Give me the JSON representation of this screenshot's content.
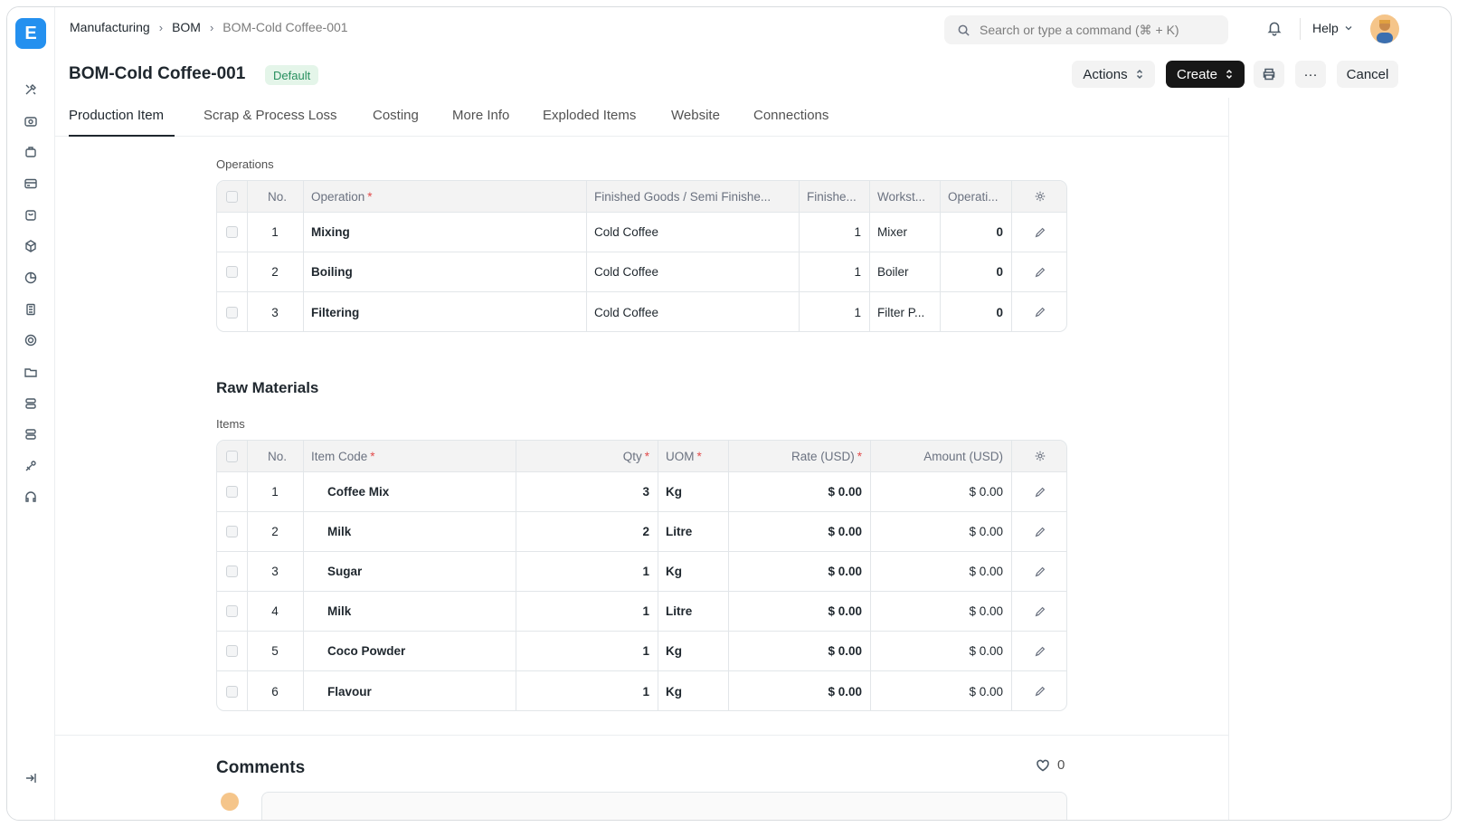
{
  "breadcrumb": [
    "Manufacturing",
    "BOM",
    "BOM-Cold Coffee-001"
  ],
  "search": {
    "placeholder": "Search or type a command (⌘ + K)"
  },
  "header": {
    "help_label": "Help"
  },
  "page": {
    "title": "BOM-Cold Coffee-001",
    "status_badge": "Default",
    "actions_label": "Actions",
    "create_label": "Create",
    "more_label": "···",
    "cancel_label": "Cancel"
  },
  "tabs": [
    "Production Item",
    "Scrap & Process Loss",
    "Costing",
    "More Info",
    "Exploded Items",
    "Website",
    "Connections"
  ],
  "operations": {
    "label": "Operations",
    "columns": [
      "No.",
      "Operation",
      "Finished Goods / Semi Finishe...",
      "Finishe...",
      "Workst...",
      "Operati..."
    ],
    "rows": [
      {
        "no": "1",
        "operation": "Mixing",
        "finished_goods": "Cold Coffee",
        "finished_qty": "1",
        "workstation": "Mixer",
        "operating_cost": "0"
      },
      {
        "no": "2",
        "operation": "Boiling",
        "finished_goods": "Cold Coffee",
        "finished_qty": "1",
        "workstation": "Boiler",
        "operating_cost": "0"
      },
      {
        "no": "3",
        "operation": "Filtering",
        "finished_goods": "Cold Coffee",
        "finished_qty": "1",
        "workstation": "Filter P...",
        "operating_cost": "0"
      }
    ]
  },
  "raw_materials": {
    "title": "Raw Materials",
    "items_label": "Items",
    "columns": [
      "No.",
      "Item Code",
      "Qty",
      "UOM",
      "Rate (USD)",
      "Amount (USD)"
    ],
    "rows": [
      {
        "no": "1",
        "item_code": "Coffee Mix",
        "qty": "3",
        "uom": "Kg",
        "rate": "$ 0.00",
        "amount": "$ 0.00"
      },
      {
        "no": "2",
        "item_code": "Milk",
        "qty": "2",
        "uom": "Litre",
        "rate": "$ 0.00",
        "amount": "$ 0.00"
      },
      {
        "no": "3",
        "item_code": "Sugar",
        "qty": "1",
        "uom": "Kg",
        "rate": "$ 0.00",
        "amount": "$ 0.00"
      },
      {
        "no": "4",
        "item_code": "Milk",
        "qty": "1",
        "uom": "Litre",
        "rate": "$ 0.00",
        "amount": "$ 0.00"
      },
      {
        "no": "5",
        "item_code": "Coco Powder",
        "qty": "1",
        "uom": "Kg",
        "rate": "$ 0.00",
        "amount": "$ 0.00"
      },
      {
        "no": "6",
        "item_code": "Flavour",
        "qty": "1",
        "uom": "Kg",
        "rate": "$ 0.00",
        "amount": "$ 0.00"
      }
    ]
  },
  "comments": {
    "title": "Comments",
    "like_count": "0"
  },
  "colors": {
    "brand": "#2490ef",
    "badge_bg": "#e4f5e9",
    "badge_text": "#278f5e",
    "primary_button": "#171717"
  }
}
